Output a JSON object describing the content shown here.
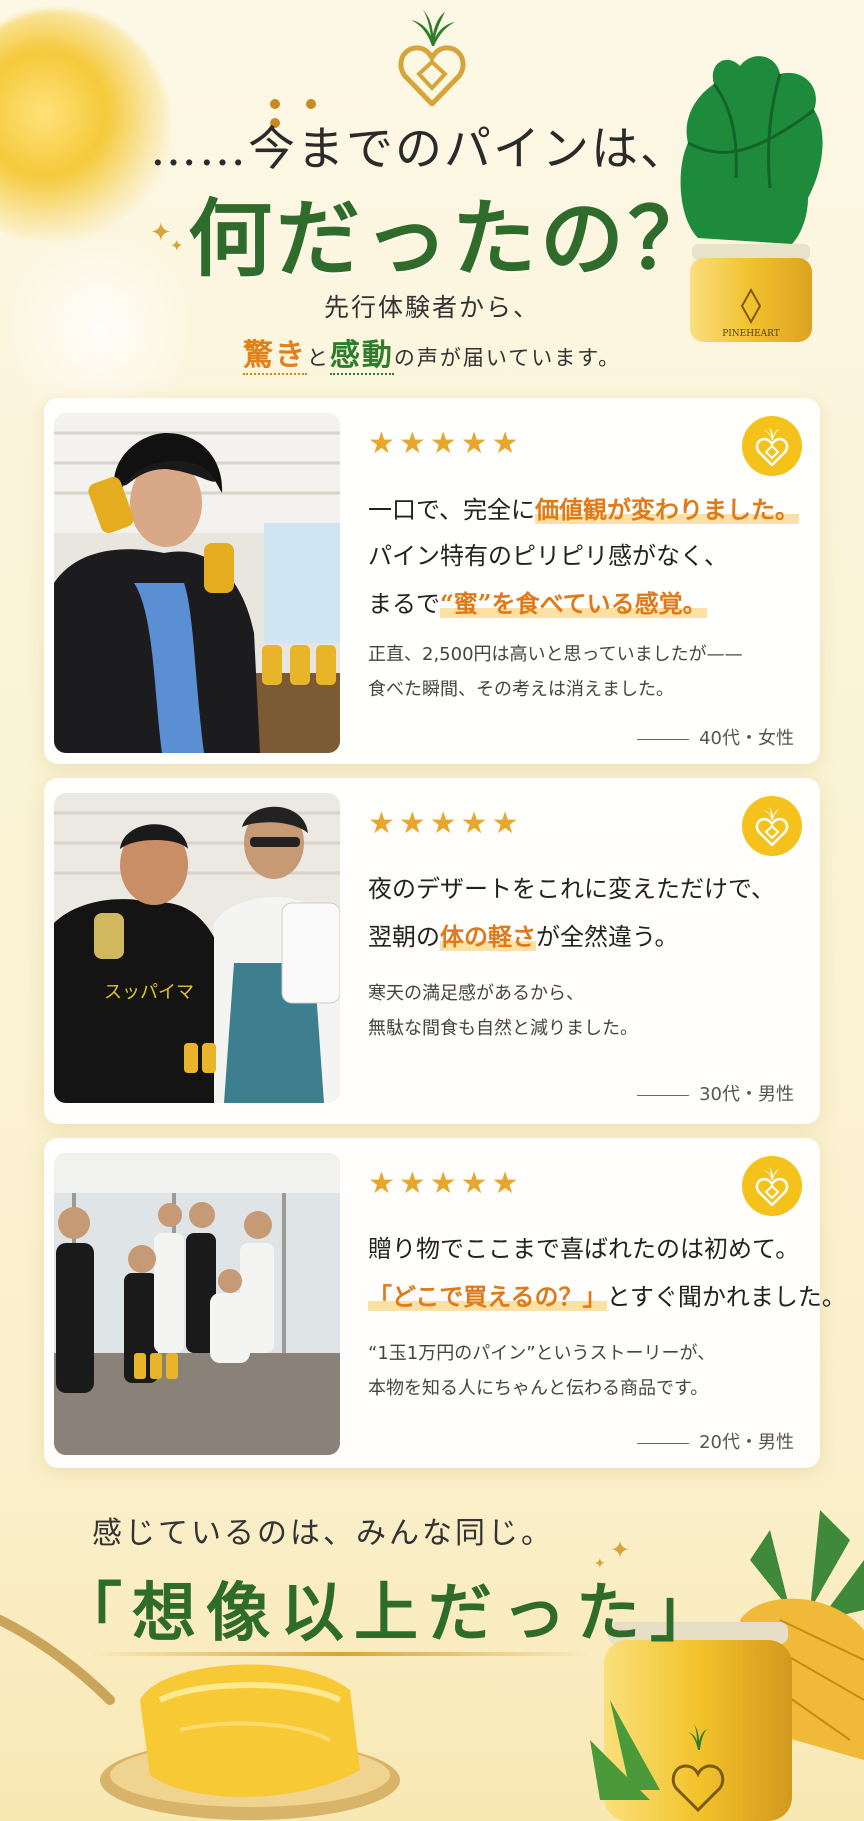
{
  "header": {
    "line1": "……今までのパインは、",
    "line2": "何だったの？",
    "sub_line1": "先行体験者から、",
    "sub_orange": "驚き",
    "sub_to": "と",
    "sub_green": "感動",
    "sub_rest": "の声が届いています。",
    "jar_label": "PINEHEART"
  },
  "reviews": [
    {
      "stars": "★★★★★",
      "photo_label": "woman-holding-bottles-photo",
      "main_lines": [
        {
          "pre": "一口で、完全に",
          "hl": "価値観が変わりました。",
          "post": ""
        },
        {
          "pre": "パイン特有のピリピリ感がなく、",
          "hl": "",
          "post": ""
        },
        {
          "pre": "まるで",
          "hl": "“蜜”を食べている感覚。",
          "post": ""
        }
      ],
      "body_lines": [
        "正直、2,500円は高いと思っていましたが——",
        "食べた瞬間、その考えは消えました。"
      ],
      "author": "40代・女性"
    },
    {
      "stars": "★★★★★",
      "photo_label": "two-men-photo",
      "main_lines": [
        {
          "pre": "夜のデザートをこれに変えただけで、",
          "hl": "",
          "post": ""
        },
        {
          "pre": "翌朝の",
          "hl": "体の軽さ",
          "post": "が全然違う。"
        }
      ],
      "body_lines": [
        "寒天の満足感があるから、",
        "無駄な間食も自然と減りました。"
      ],
      "author": "30代・男性"
    },
    {
      "stars": "★★★★★",
      "photo_label": "group-photo",
      "main_lines": [
        {
          "pre": "贈り物でここまで喜ばれたのは初めて。",
          "hl": "",
          "post": ""
        },
        {
          "pre": "",
          "hl": "「どこで買えるの？」",
          "post": "とすぐ聞かれました。"
        }
      ],
      "body_lines": [
        "“1玉1万円のパイン”というストーリーが、",
        "本物を知る人にちゃんと伝わる商品です。"
      ],
      "author": "20代・男性"
    }
  ],
  "footer": {
    "line1": "感じているのは、みんな同じ。",
    "line2": "「想像以上だった」"
  },
  "colors": {
    "accent_orange": "#e07a18",
    "accent_green": "#2f6b2a",
    "star_gold": "#e7a72c",
    "badge_yellow": "#f4c21b"
  }
}
